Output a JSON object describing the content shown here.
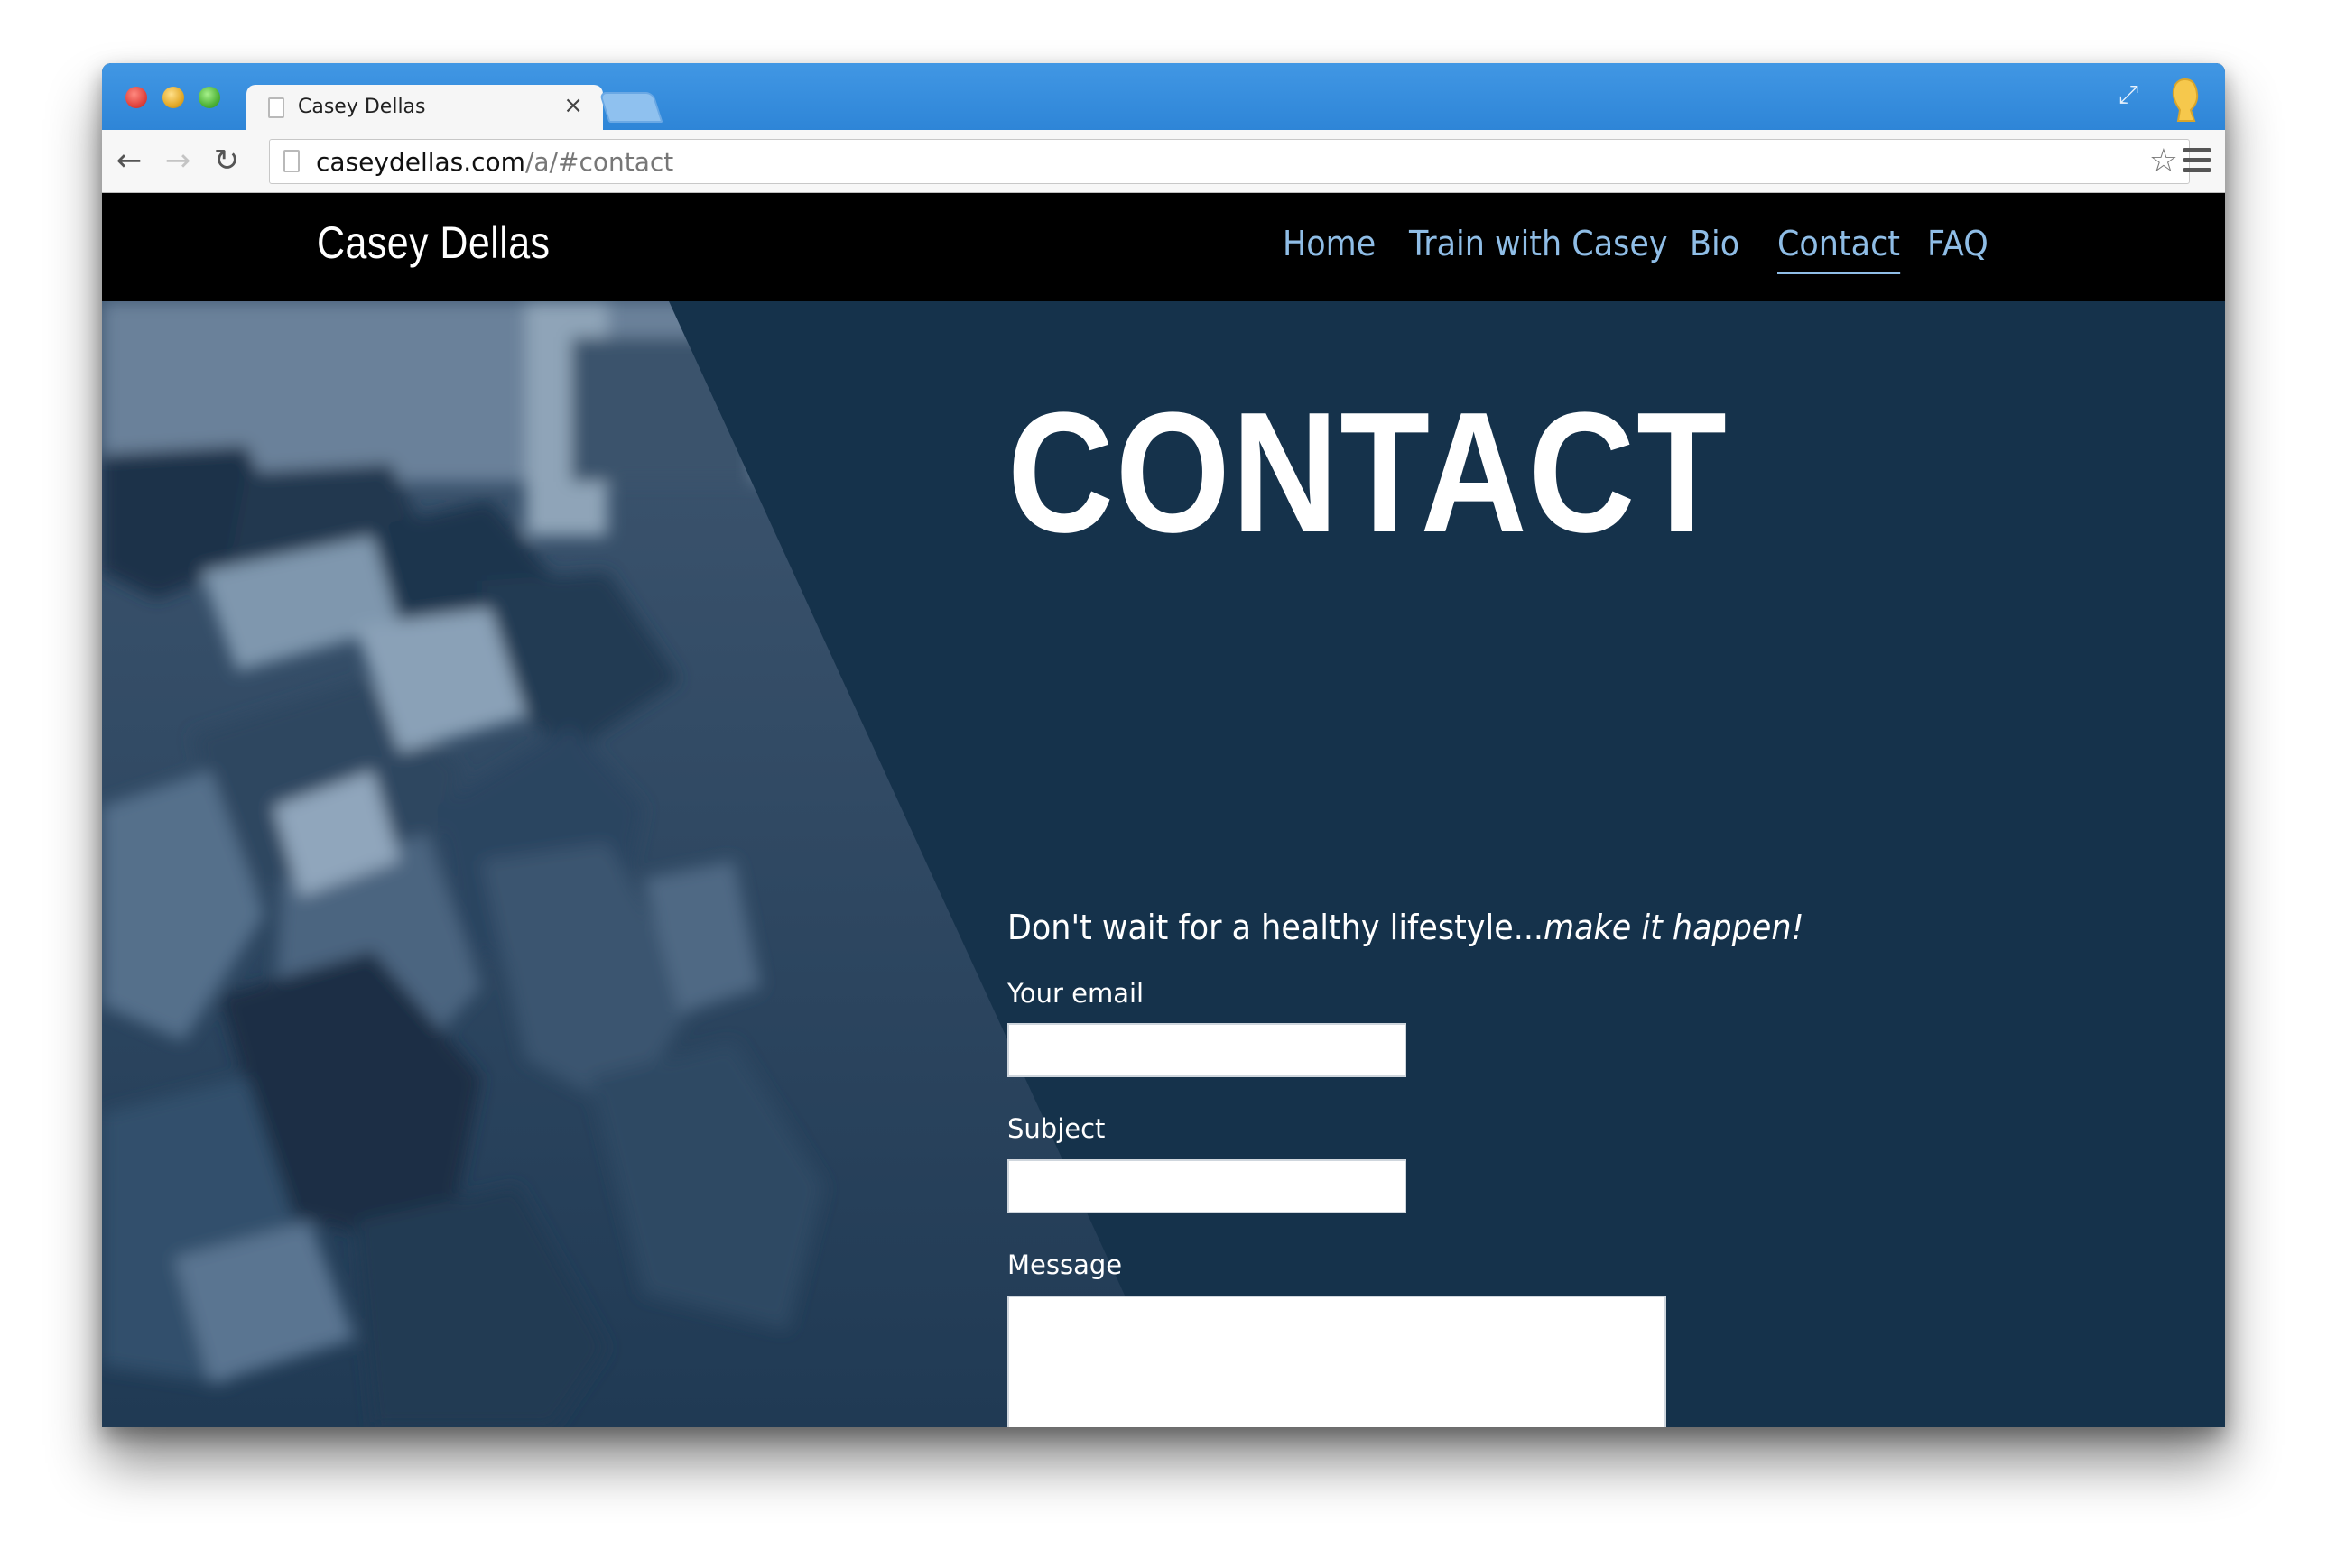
{
  "browser": {
    "tab_title": "Casey Dellas",
    "tab_close_icon": "×",
    "url_domain": "caseydellas.com",
    "url_path": "/a/#contact",
    "back_icon": "arrow-left",
    "forward_icon": "arrow-right",
    "reload_icon": "reload",
    "bookmark_icon": "star-outline",
    "menu_icon": "hamburger-menu"
  },
  "site": {
    "brand": "Casey Dellas",
    "nav": [
      {
        "label": "Home",
        "active": false
      },
      {
        "label": "Train with Casey",
        "active": false
      },
      {
        "label": "Bio",
        "active": false
      },
      {
        "label": "Contact",
        "active": true
      },
      {
        "label": "FAQ",
        "active": false
      }
    ],
    "colors": {
      "nav_bg": "#000000",
      "nav_link": "#8fbde6",
      "page_bg": "#15324b"
    }
  },
  "contact": {
    "title": "CONTACT",
    "tagline_plain": "Don't wait for a healthy lifestyle...",
    "tagline_italic": "make it happen!",
    "email_label": "Your email",
    "email_value": "",
    "subject_label": "Subject",
    "subject_value": "",
    "message_label": "Message",
    "message_value": ""
  }
}
